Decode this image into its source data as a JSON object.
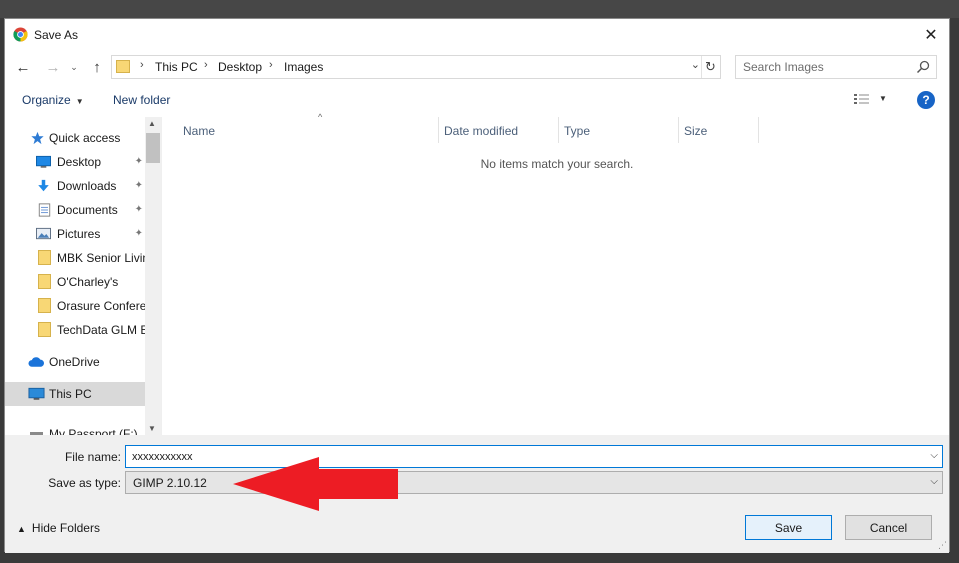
{
  "window": {
    "title": "Save As",
    "close_glyph": "✕"
  },
  "nav": {
    "back_glyph": "←",
    "forward_glyph": "→",
    "recent_glyph": "⌄",
    "up_glyph": "↑",
    "breadcrumbs": [
      "This PC",
      "Desktop",
      "Images"
    ],
    "separator": "›",
    "dropdown_glyph": "⌄",
    "refresh_glyph": "↻"
  },
  "search": {
    "placeholder": "Search Images"
  },
  "toolbar": {
    "organize": "Organize",
    "new_folder": "New folder",
    "caret": "▼",
    "help": "?"
  },
  "sidebar": {
    "items": [
      {
        "label": "Quick access",
        "icon": "star-icon",
        "pinned": false
      },
      {
        "label": "Desktop",
        "icon": "desktop-icon",
        "pinned": true
      },
      {
        "label": "Downloads",
        "icon": "download-icon",
        "pinned": true
      },
      {
        "label": "Documents",
        "icon": "documents-icon",
        "pinned": true
      },
      {
        "label": "Pictures",
        "icon": "pictures-icon",
        "pinned": true
      },
      {
        "label": "MBK Senior Livin",
        "icon": "folder-icon",
        "pinned": false
      },
      {
        "label": "O'Charley's",
        "icon": "folder-icon",
        "pinned": false
      },
      {
        "label": "Orasure Confere",
        "icon": "folder-icon",
        "pinned": false
      },
      {
        "label": "TechData GLM E",
        "icon": "folder-icon",
        "pinned": false
      },
      {
        "label": "OneDrive",
        "icon": "cloud-icon",
        "pinned": false
      },
      {
        "label": "This PC",
        "icon": "computer-icon",
        "pinned": false,
        "selected": true
      },
      {
        "label": "My Passport (F:)",
        "icon": "drive-icon",
        "pinned": false
      }
    ],
    "pin_glyph": "📌"
  },
  "columns": [
    "Name",
    "Date modified",
    "Type",
    "Size"
  ],
  "empty_message": "No items match your search.",
  "bottom": {
    "filename_label": "File name:",
    "filename_value": "xxxxxxxxxxx",
    "savetype_label": "Save as type:",
    "savetype_value": "GIMP 2.10.12",
    "hide_folders": "Hide Folders",
    "save": "Save",
    "cancel": "Cancel"
  },
  "colors": {
    "accent": "#0078d7",
    "annotation_arrow": "#ed1c24",
    "help": "#1764c6"
  }
}
